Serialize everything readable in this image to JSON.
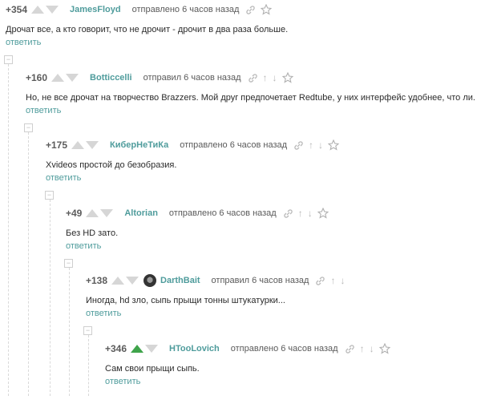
{
  "actions": {
    "reply_label": "ответить",
    "collapse_label": "−"
  },
  "comments": [
    {
      "rating": "+354",
      "author": "JamesFloyd",
      "time": "отправлено 6 часов назад",
      "text": "Дрочат все, а кто говорит, что не дрочит - дрочит в два раза больше."
    },
    {
      "rating": "+160",
      "author": "Botticcelli",
      "time": "отправил 6 часов назад",
      "text": "Но, не все дрочат на творчество Brazzers. Мой друг предпочетает Redtube, у них интерфейс удобнее, что ли."
    },
    {
      "rating": "+175",
      "author": "КиберНеТиКа",
      "time": "отправлено 6 часов назад",
      "text": "Xvideos простой до безобразия."
    },
    {
      "rating": "+49",
      "author": "Altorian",
      "time": "отправлено 6 часов назад",
      "text": "Без HD зато."
    },
    {
      "rating": "+138",
      "author": "DarthBait",
      "time": "отправил 6 часов назад",
      "text": "Иногда, hd зло, сыпь прыщи тонны штукатурки..."
    },
    {
      "rating": "+346",
      "author": "HTooLovich",
      "time": "отправлено 6 часов назад",
      "text": "Сам свои прыщи сыпь."
    }
  ],
  "colors": {
    "author": "#4f9c9c",
    "upvote_active": "#3fa44b",
    "icon": "#b9b9b9"
  },
  "icons": [
    "link-icon",
    "star-icon",
    "up-arrow-icon",
    "down-arrow-icon"
  ]
}
